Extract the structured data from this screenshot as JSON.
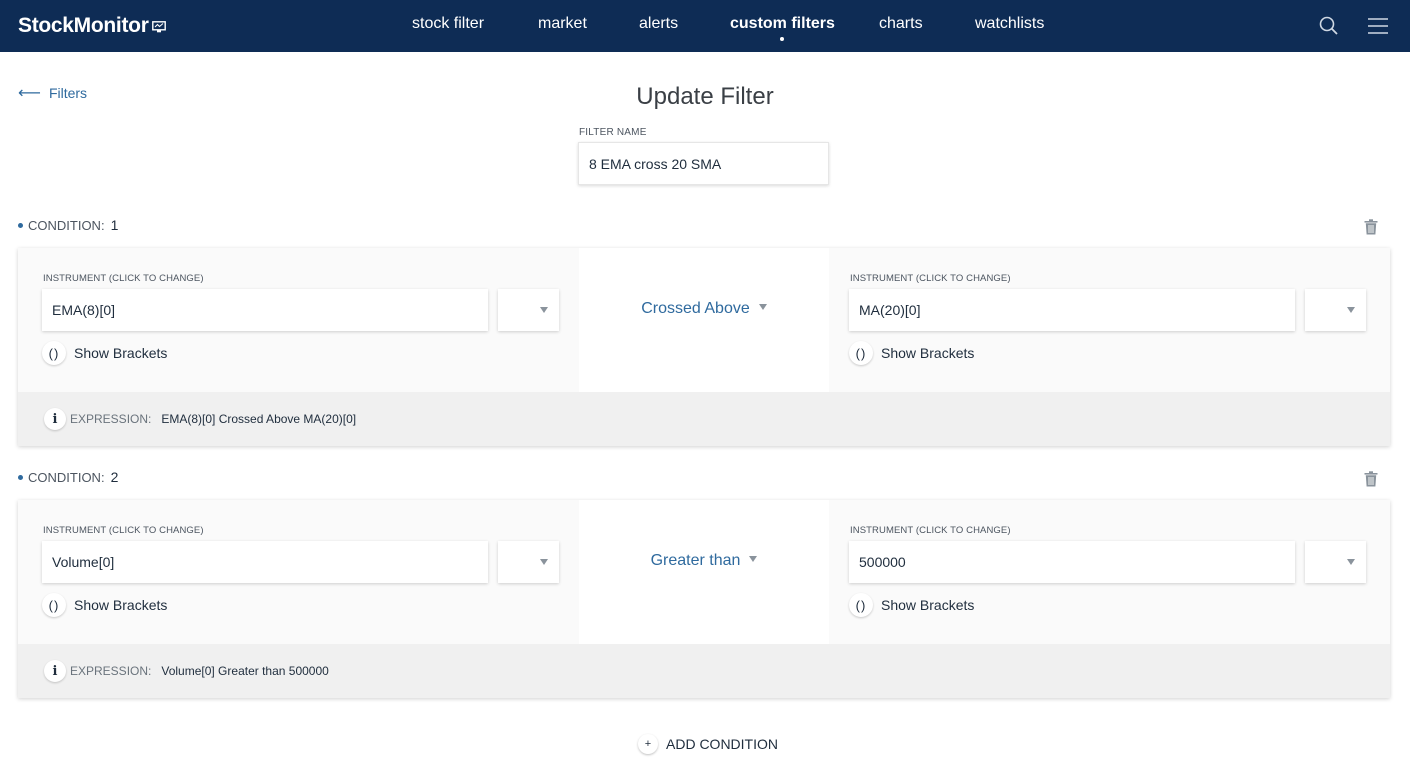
{
  "header": {
    "logo_text": "StockMonitor",
    "nav": [
      {
        "label": "stock filter",
        "active": false
      },
      {
        "label": "market",
        "active": false
      },
      {
        "label": "alerts",
        "active": false
      },
      {
        "label": "custom filters",
        "active": true
      },
      {
        "label": "charts",
        "active": false
      },
      {
        "label": "watchlists",
        "active": false
      }
    ],
    "icons": [
      "search-icon",
      "menu-icon"
    ]
  },
  "back_link": {
    "label": "Filters"
  },
  "page_title": "Update Filter",
  "filter_name": {
    "label": "FILTER NAME",
    "value": "8 EMA cross 20 SMA"
  },
  "conditions": [
    {
      "header_label": "CONDITION:",
      "number": "1",
      "left": {
        "label": "INSTRUMENT (CLICK TO CHANGE)",
        "value": "EMA(8)[0]",
        "brackets_label": "Show Brackets",
        "brackets_symbol": "()"
      },
      "operator": "Crossed Above",
      "right": {
        "label": "INSTRUMENT (CLICK TO CHANGE)",
        "value": "MA(20)[0]",
        "brackets_label": "Show Brackets",
        "brackets_symbol": "()"
      },
      "expression_label": "EXPRESSION:",
      "expression": "EMA(8)[0] Crossed Above MA(20)[0]"
    },
    {
      "header_label": "CONDITION:",
      "number": "2",
      "left": {
        "label": "INSTRUMENT (CLICK TO CHANGE)",
        "value": "Volume[0]",
        "brackets_label": "Show Brackets",
        "brackets_symbol": "()"
      },
      "operator": "Greater than",
      "right": {
        "label": "INSTRUMENT (CLICK TO CHANGE)",
        "value": "500000",
        "brackets_label": "Show Brackets",
        "brackets_symbol": "()"
      },
      "expression_label": "EXPRESSION:",
      "expression": "Volume[0] Greater than 500000"
    }
  ],
  "add_condition": {
    "symbol": "+",
    "label": "ADD CONDITION"
  },
  "colors": {
    "nav_bg": "#0e2c55",
    "accent": "#2f6a9e",
    "card_bg": "#fafafa",
    "footer_bg": "#f0f0f0"
  }
}
